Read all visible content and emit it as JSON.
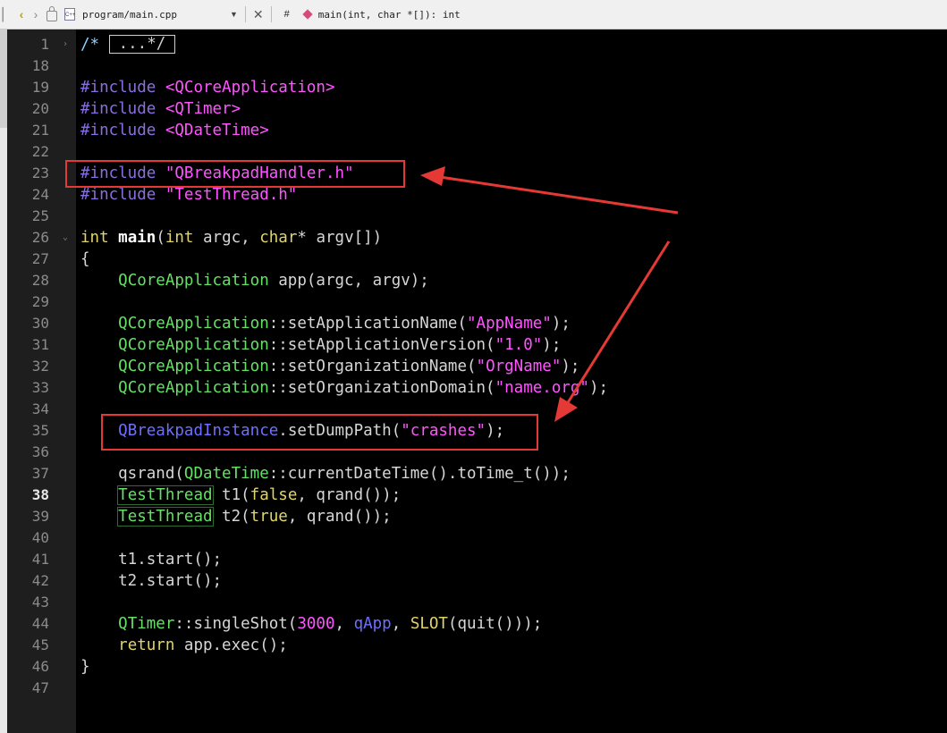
{
  "toolbar": {
    "file_name": "program/main.cpp",
    "file_icon_label": "C++",
    "hash_label": "#",
    "function_signature": "main(int, char *[]): int"
  },
  "editor": {
    "current_line": 38,
    "line_numbers": [
      "1",
      "18",
      "19",
      "20",
      "21",
      "22",
      "23",
      "24",
      "25",
      "26",
      "27",
      "28",
      "29",
      "30",
      "31",
      "32",
      "33",
      "34",
      "35",
      "36",
      "37",
      "38",
      "39",
      "40",
      "41",
      "42",
      "43",
      "44",
      "45",
      "46",
      "47"
    ],
    "fold_comment": "...*/"
  },
  "icons": [
    "back-arrow-icon",
    "forward-arrow-icon",
    "lock-icon",
    "cpp-file-icon",
    "chevron-down-icon",
    "close-icon",
    "function-icon"
  ],
  "colors": {
    "background": "#000000",
    "annotation": "#e53935",
    "string": "#ff55ff",
    "class": "#66e066",
    "keyword": "#e0d46a"
  }
}
